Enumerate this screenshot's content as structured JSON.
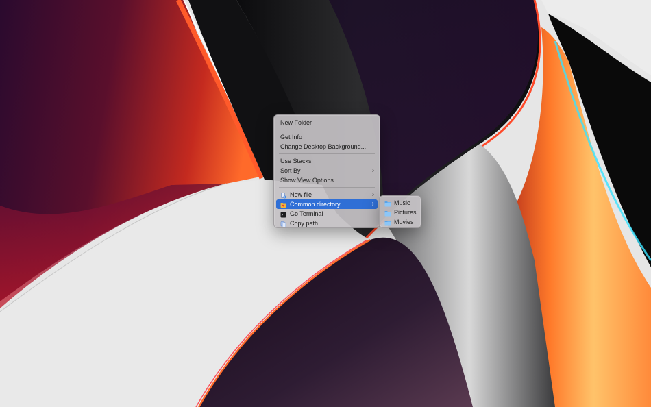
{
  "desktop": {
    "colors": {
      "accent": "#2f6fd6",
      "menu_bg": "#c4c1c4"
    }
  },
  "context_menu": {
    "items": [
      {
        "label": "New Folder"
      },
      {
        "label": "Get Info"
      },
      {
        "label": "Change Desktop Background..."
      },
      {
        "label": "Use Stacks"
      },
      {
        "label": "Sort By",
        "has_submenu": true
      },
      {
        "label": "Show View Options"
      },
      {
        "label": "New file",
        "icon": "new-file-icon",
        "has_submenu": true
      },
      {
        "label": "Common directory",
        "icon": "folder-heart-icon",
        "has_submenu": true,
        "highlighted": true
      },
      {
        "label": "Go Terminal",
        "icon": "terminal-icon"
      },
      {
        "label": "Copy path",
        "icon": "copy-path-icon"
      }
    ]
  },
  "submenu": {
    "items": [
      {
        "label": "Music",
        "icon": "folder-icon"
      },
      {
        "label": "Pictures",
        "icon": "folder-icon"
      },
      {
        "label": "Movies",
        "icon": "folder-icon"
      }
    ]
  }
}
